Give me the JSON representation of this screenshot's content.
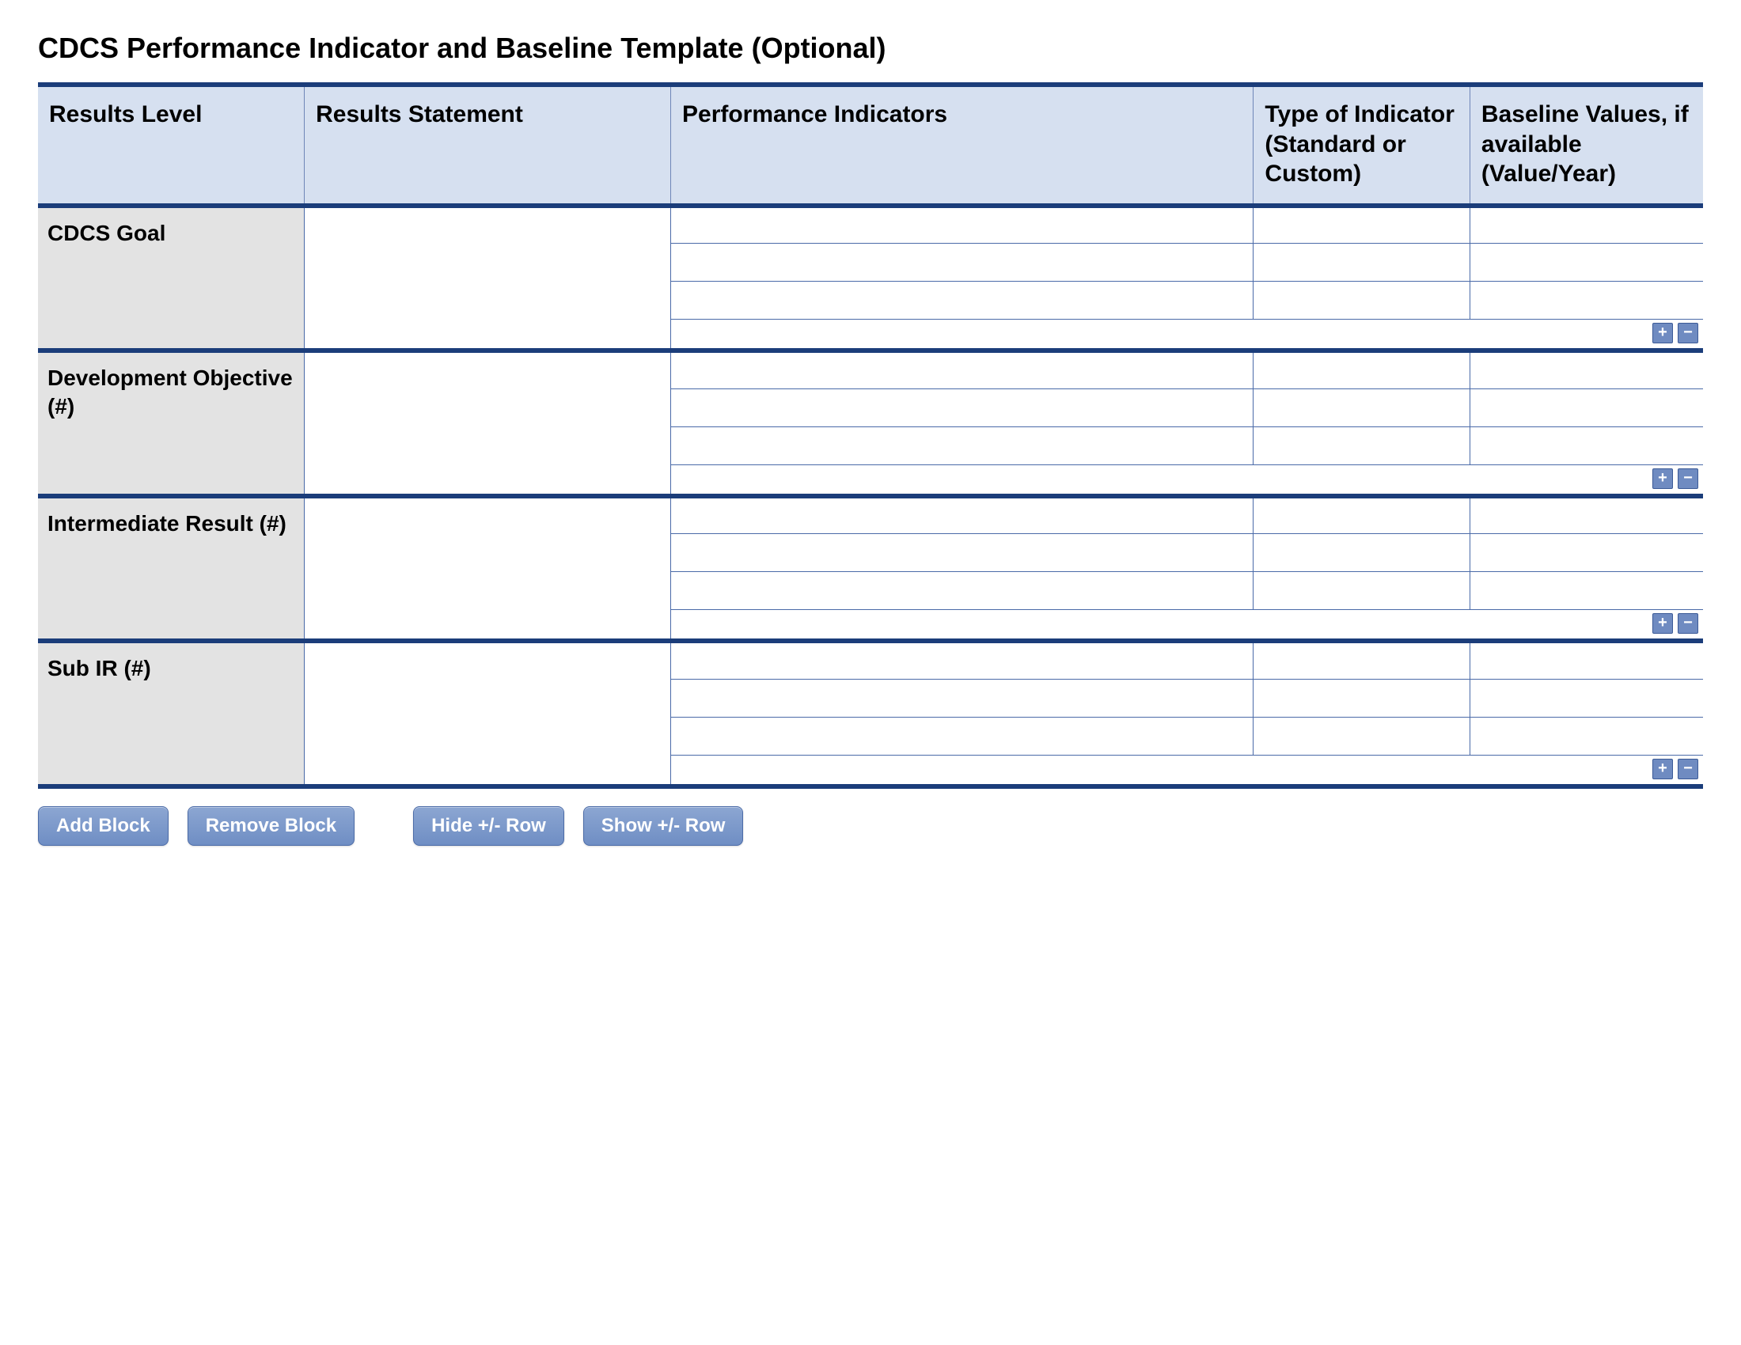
{
  "title": "CDCS Performance Indicator and Baseline Template (Optional)",
  "headers": {
    "results_level": "Results Level",
    "results_statement": "Results Statement",
    "performance_indicators": "Performance Indicators",
    "type_of_indicator": "Type of Indicator (Standard or Custom)",
    "baseline_values": "Baseline Values, if available (Value/Year)"
  },
  "sections": [
    {
      "label": "CDCS Goal"
    },
    {
      "label": "Development Objective (#)"
    },
    {
      "label": "Intermediate Result (#)"
    },
    {
      "label": "Sub IR (#)"
    }
  ],
  "mini_buttons": {
    "plus": "+",
    "minus": "−"
  },
  "footer_buttons": {
    "add_block": "Add Block",
    "remove_block": "Remove Block",
    "hide_row": "Hide +/- Row",
    "show_row": "Show +/- Row"
  }
}
